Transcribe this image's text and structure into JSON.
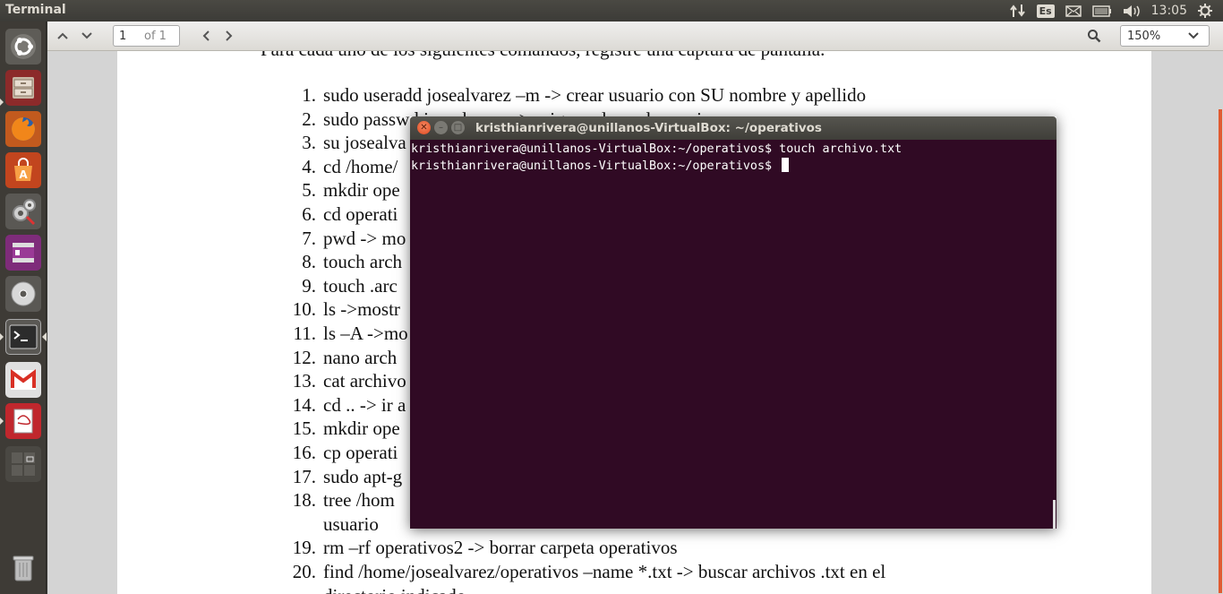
{
  "top_panel": {
    "app_title": "Terminal",
    "keyboard_layout": "Es",
    "clock": "13:05"
  },
  "launcher": {
    "items": [
      {
        "name": "dash-home",
        "icon": "ubuntu-logo-icon"
      },
      {
        "name": "files",
        "icon": "file-cabinet-icon"
      },
      {
        "name": "firefox",
        "icon": "firefox-icon"
      },
      {
        "name": "software-center",
        "icon": "shopping-bag-icon"
      },
      {
        "name": "system-settings",
        "icon": "gears-icon"
      },
      {
        "name": "video",
        "icon": "film-icon"
      },
      {
        "name": "disc",
        "icon": "disc-icon"
      },
      {
        "name": "terminal",
        "icon": "terminal-icon"
      },
      {
        "name": "gmail",
        "icon": "gmail-icon"
      },
      {
        "name": "document-viewer",
        "icon": "document-viewer-icon"
      },
      {
        "name": "workspace-switcher",
        "icon": "workspaces-icon"
      },
      {
        "name": "trash",
        "icon": "trash-icon"
      }
    ]
  },
  "viewer": {
    "page_number": "1",
    "page_of": "of 1",
    "zoom": "150%",
    "intro": "Para cada uno de los siguientes comandos, registre una captura de pantalla.",
    "list": [
      {
        "num": "1.",
        "text": "sudo  useradd josealvarez –m -> crear usuario con SU nombre y apellido"
      },
      {
        "num": "2.",
        "text": "sudo passwd josealvarez -> asignar clave al usuario"
      },
      {
        "num": "3.",
        "text": "su josealva"
      },
      {
        "num": "4.",
        "text": "cd /home/"
      },
      {
        "num": "5.",
        "text": "mkdir ope"
      },
      {
        "num": "6.",
        "text": "cd operati"
      },
      {
        "num": "7.",
        "text": "pwd -> mo"
      },
      {
        "num": "8.",
        "text": "touch arch"
      },
      {
        "num": "9.",
        "text": "touch .arc"
      },
      {
        "num": "10.",
        "text": "ls ->mostr"
      },
      {
        "num": "11.",
        "text": "ls –A ->mo"
      },
      {
        "num": "12.",
        "text": "nano arch"
      },
      {
        "num": "13.",
        "text": "cat archivo"
      },
      {
        "num": "14.",
        "text": "cd .. -> ir a"
      },
      {
        "num": "15.",
        "text": "mkdir ope"
      },
      {
        "num": "16.",
        "text": "cp operati"
      },
      {
        "num": "17.",
        "text": "sudo apt-g"
      },
      {
        "num": "18.",
        "text": "tree /hom"
      },
      {
        "num": "",
        "text": "usuario"
      },
      {
        "num": "19.",
        "text": "rm –rf operativos2 -> borrar carpeta operativos"
      },
      {
        "num": "20.",
        "text": "find /home/josealvarez/operativos –name *.txt -> buscar archivos .txt en el"
      },
      {
        "num": "",
        "text": "directorio indicado"
      }
    ]
  },
  "terminal": {
    "title": "kristhianrivera@unillanos-VirtualBox: ~/operativos",
    "lines": [
      "kristhianrivera@unillanos-VirtualBox:~/operativos$ touch archivo.txt",
      "kristhianrivera@unillanos-VirtualBox:~/operativos$ "
    ],
    "colors": {
      "background": "#300a24",
      "text": "#ffffff"
    }
  }
}
